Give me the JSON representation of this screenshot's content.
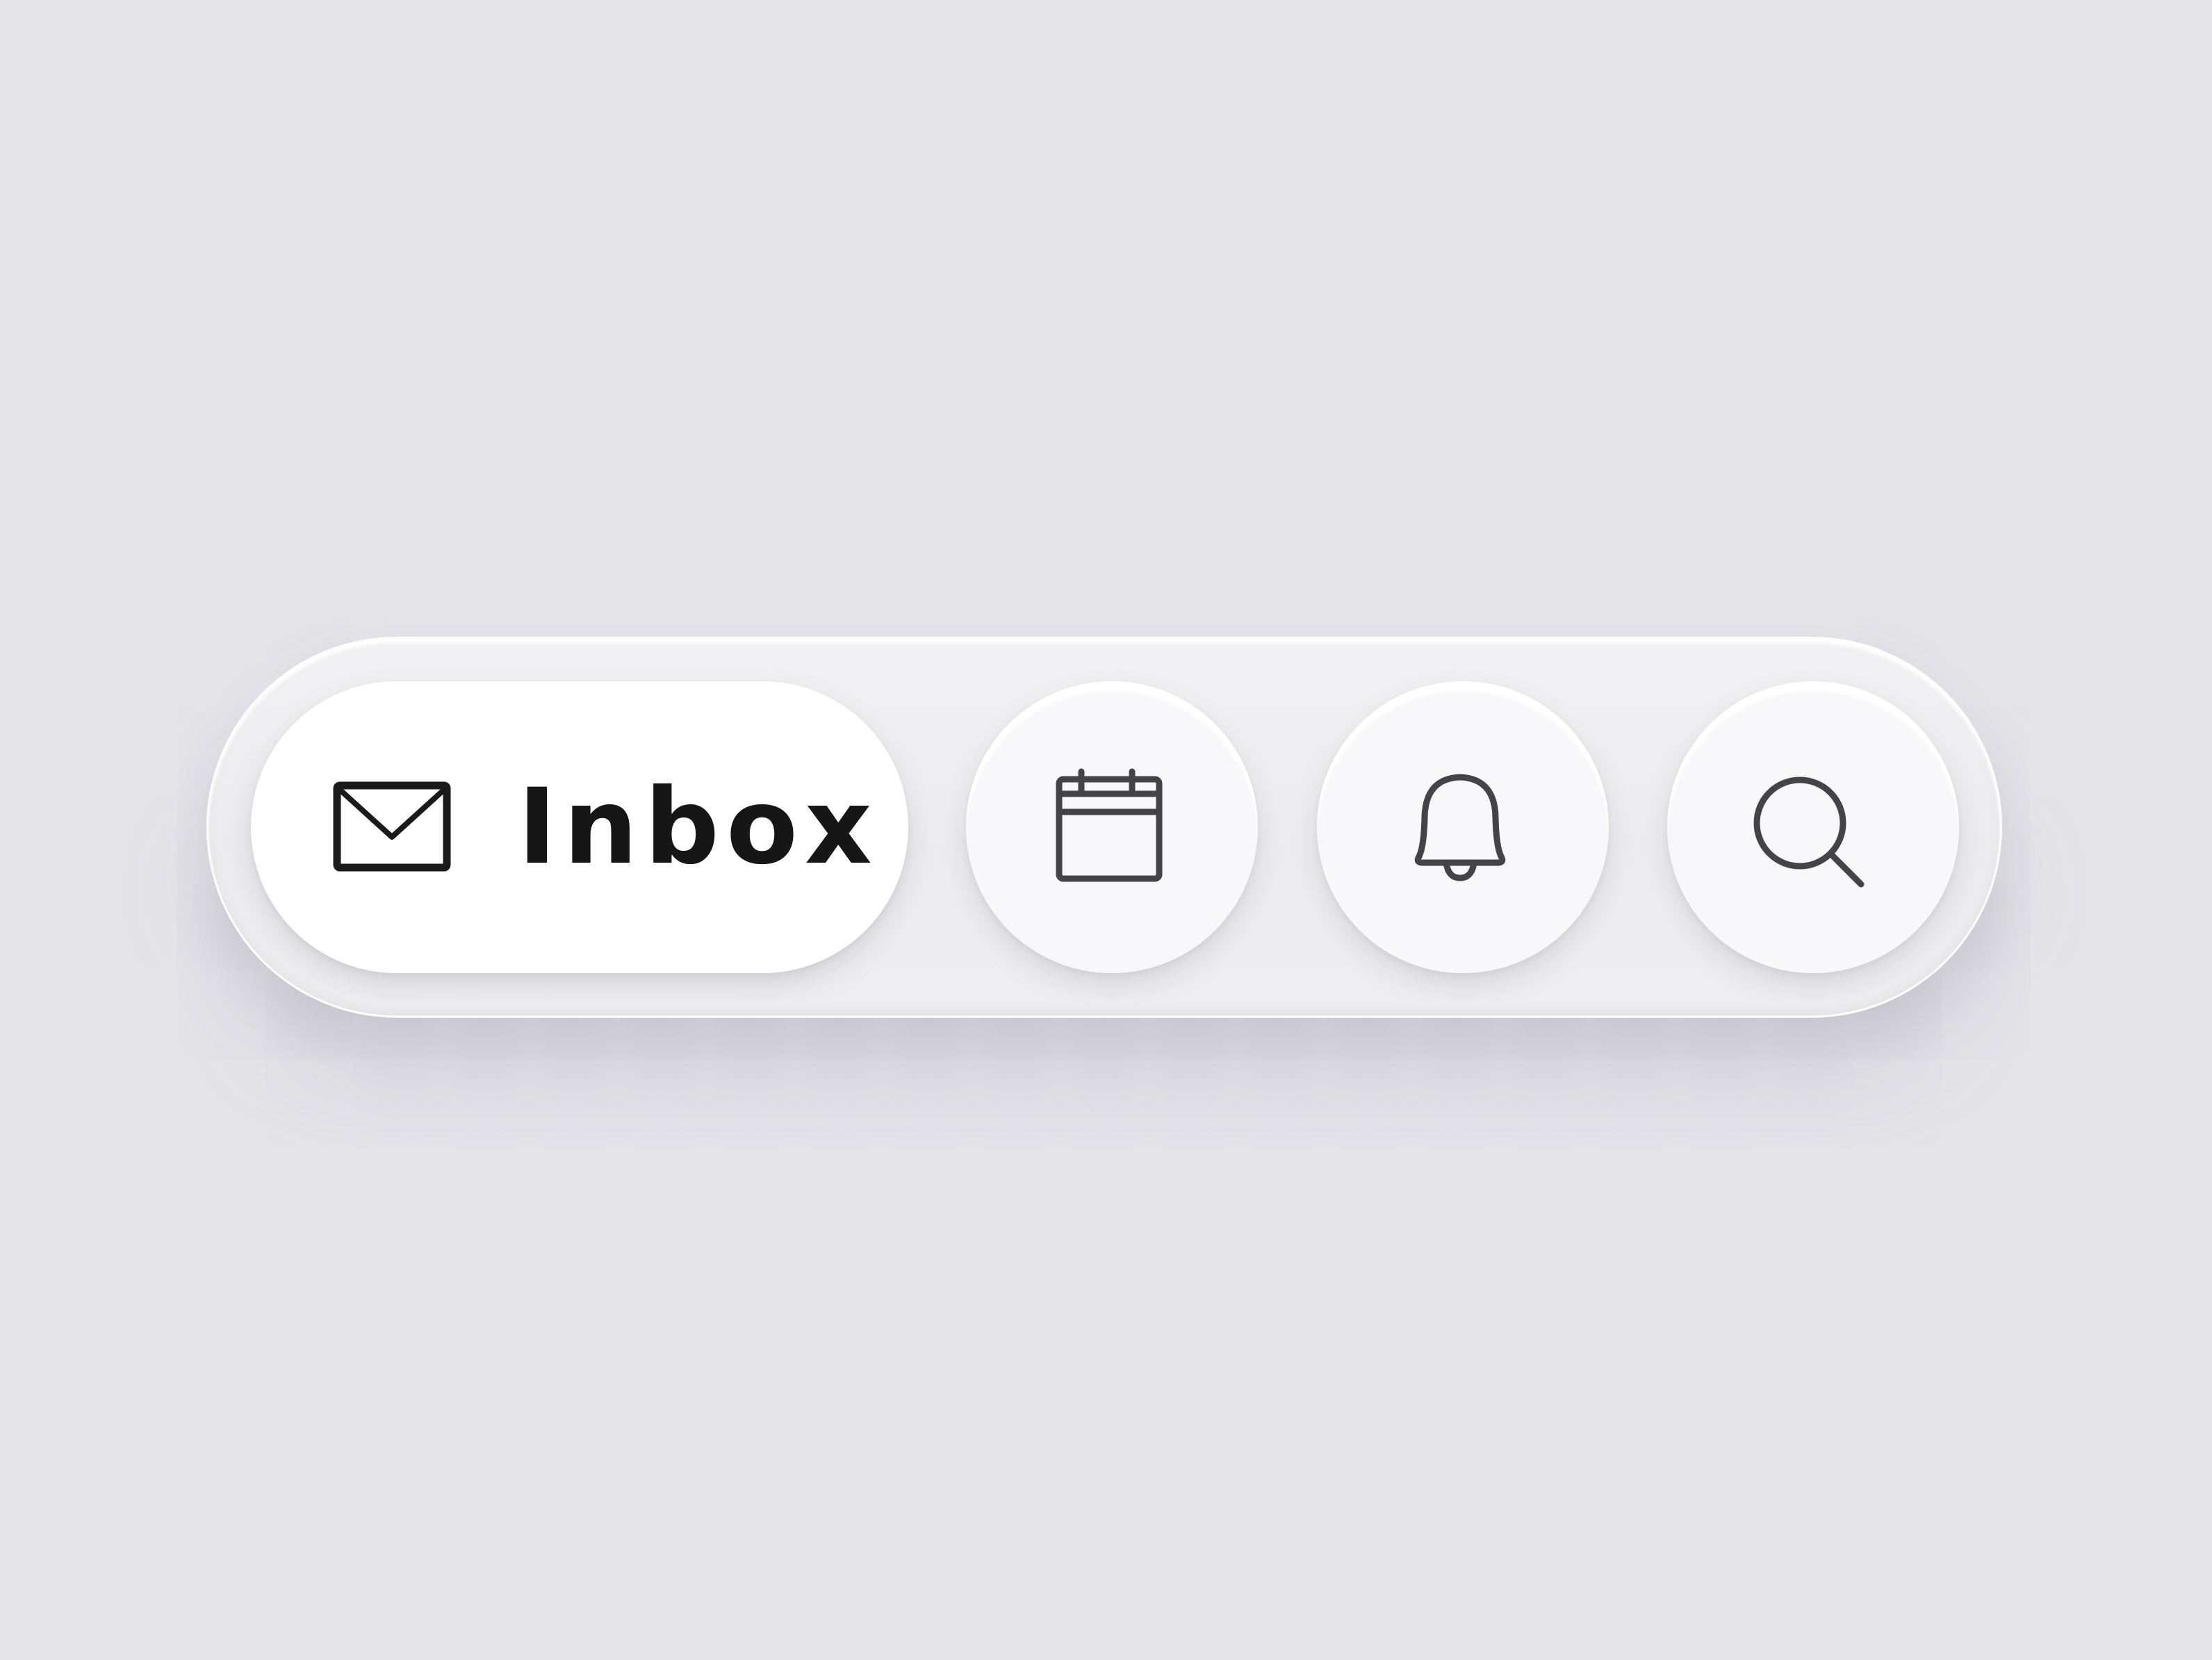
{
  "nav": {
    "inbox": {
      "label": "Inbox",
      "icon": "mail-icon",
      "active": true
    },
    "buttons": [
      {
        "icon": "calendar-icon"
      },
      {
        "icon": "bell-icon"
      },
      {
        "icon": "search-icon"
      }
    ]
  },
  "colors": {
    "background": "#e5e4e9",
    "bar": "#eeeef0",
    "active_pill": "#ffffff",
    "button": "#f8f8fa",
    "label_text": "#161616",
    "icon_stroke": "#444448",
    "active_icon_stroke": "#1a1a1a"
  }
}
